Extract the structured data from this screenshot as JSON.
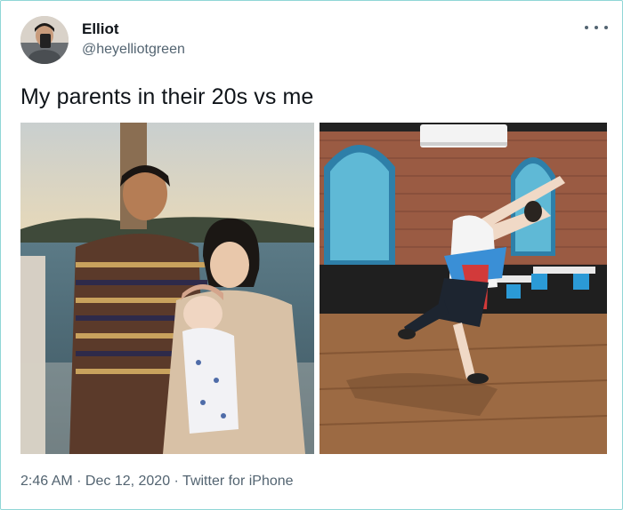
{
  "tweet": {
    "author_name": "Elliot",
    "author_handle": "@heyelliotgreen",
    "text": "My parents in their 20s vs me",
    "timestamp_time": "2:46 AM",
    "separator": " · ",
    "timestamp_date": "Dec 12, 2020",
    "source": "Twitter for iPhone"
  },
  "icons": {
    "more": "more-horizontal-icon",
    "avatar": "profile-avatar"
  },
  "colors": {
    "text_primary": "#0f1419",
    "text_secondary": "#536471",
    "border": "#8fd6d6"
  }
}
